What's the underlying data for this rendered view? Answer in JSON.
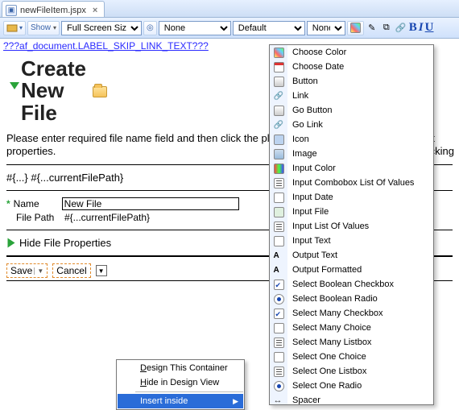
{
  "tab": {
    "label": "newFileItem.jspx",
    "close": "×"
  },
  "toolbar": {
    "show": "Show",
    "sel1": "Full Screen Size",
    "sel2": "None",
    "sel3": "Default",
    "sel4": "None",
    "bold": "B",
    "italic": "I",
    "underline": "U"
  },
  "doclink": "???af_document.LABEL_SKIP_LINK_TEXT???",
  "header": {
    "title_line1": "Create",
    "title_line2": "New",
    "title_line3": "File"
  },
  "help_para": "Please enter required file name field and then click the plus sign icon below to modify default properties.",
  "help_tail": "Clicking",
  "exprs": "#{...} #{...currentFilePath}",
  "form": {
    "name_label": "Name",
    "name_value": "New File",
    "path_label": "File Path",
    "path_value": "#{...currentFilePath}"
  },
  "hide_props": "Hide File Properties",
  "buttons": {
    "save": "Save",
    "cancel": "Cancel"
  },
  "ctx": {
    "design_container": "Design This Container",
    "hide_design": "Hide in Design View",
    "insert_inside": "Insert inside"
  },
  "menu_items": [
    "Choose Color",
    "Choose Date",
    "Button",
    "Link",
    "Go Button",
    "Go Link",
    "Icon",
    "Image",
    "Input Color",
    "Input Combobox List Of Values",
    "Input Date",
    "Input File",
    "Input List Of Values",
    "Input Text",
    "Output Text",
    "Output Formatted",
    "Select Boolean Checkbox",
    "Select Boolean Radio",
    "Select Many Checkbox",
    "Select Many Choice",
    "Select Many Listbox",
    "Select One Choice",
    "Select One Listbox",
    "Select One Radio",
    "Spacer"
  ],
  "menu_icons": [
    "ic-palette",
    "ic-calendar",
    "ic-button",
    "ic-link",
    "ic-go",
    "ic-link",
    "ic-box",
    "ic-image",
    "ic-color",
    "ic-list",
    "ic-date",
    "ic-file",
    "ic-list",
    "ic-text",
    "ic-outtext",
    "ic-outtext",
    "ic-check",
    "ic-radio",
    "ic-check",
    "ic-select",
    "ic-list",
    "ic-select",
    "ic-list",
    "ic-radio",
    "ic-spacer"
  ]
}
